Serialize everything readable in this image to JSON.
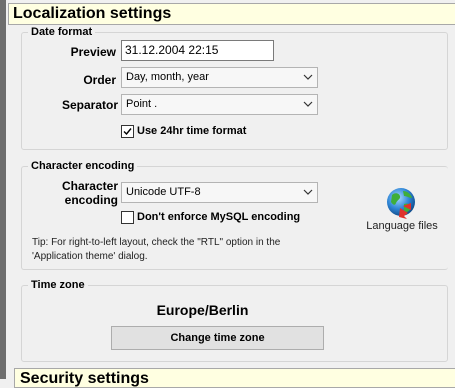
{
  "title": "Localization settings",
  "date_format": {
    "title": "Date format",
    "preview_label": "Preview",
    "preview_value": "31.12.2004 22:15",
    "order_label": "Order",
    "order_value": "Day, month, year",
    "separator_label": "Separator",
    "separator_value": "Point .",
    "use24_label": "Use 24hr time format",
    "use24_checked": true
  },
  "character_encoding": {
    "title": "Character encoding",
    "encoding_label_line1": "Character",
    "encoding_label_line2": "encoding",
    "encoding_value": "Unicode UTF-8",
    "no_mysql_label": "Don't enforce MySQL encoding",
    "no_mysql_checked": false,
    "tip_line1": "Tip: For right-to-left layout, check the \"RTL\" option in the",
    "tip_line2": "'Application theme' dialog.",
    "language_files_label": "Language files"
  },
  "time_zone": {
    "title": "Time zone",
    "value": "Europe/Berlin",
    "change_button": "Change time zone"
  },
  "next_section_title": "Security settings",
  "icons": {
    "dropdown": "chevron-down-icon",
    "checkmark": "checkmark-icon",
    "language_files": "globe-icon"
  }
}
